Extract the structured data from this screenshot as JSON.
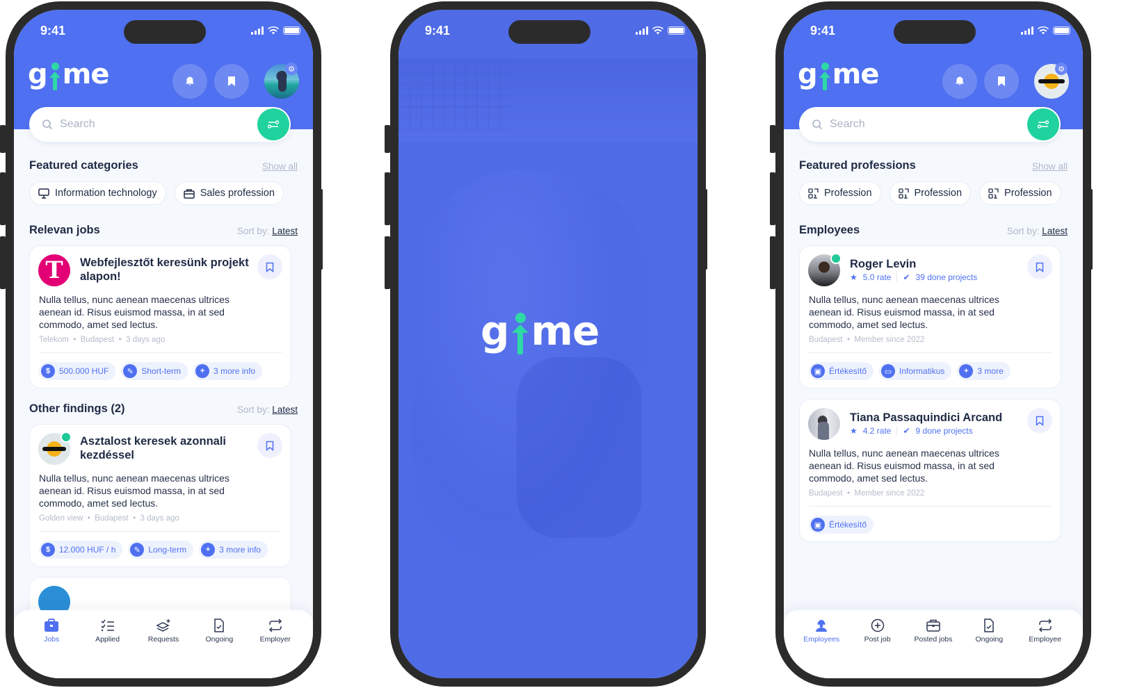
{
  "colors": {
    "brand": "#4f70f0",
    "accent_green": "#20d39e",
    "text_dark": "#1f2a44",
    "muted": "#b5bccb",
    "bg": "#f5f8fd"
  },
  "status_bar": {
    "time": "9:41"
  },
  "brand": {
    "logo_prefix": "g",
    "logo_suffix": "me"
  },
  "phone1": {
    "search_placeholder": "Search",
    "featured": {
      "title": "Featured categories",
      "show_all": "Show all",
      "chips": [
        {
          "icon": "monitor-icon",
          "label": "Information technology"
        },
        {
          "icon": "briefcase-icon",
          "label": "Sales profession"
        }
      ]
    },
    "relevant": {
      "title": "Relevan jobs",
      "sort_label": "Sort by:",
      "sort_value": "Latest"
    },
    "jobs": [
      {
        "title": "Webfejlesztőt keresünk projekt alapon!",
        "description": "Nulla tellus, nunc aenean maecenas ultrices aenean id. Risus euismod massa, in at sed commodo, amet sed lectus.",
        "company": "Telekom",
        "location": "Budapest",
        "posted": "3 days ago",
        "tags": [
          {
            "icon": "dollar-icon",
            "label": "500.000 HUF"
          },
          {
            "icon": "contract-icon",
            "label": "Short-term"
          },
          {
            "icon": "plus-icon",
            "label": "3 more info"
          }
        ]
      }
    ],
    "other": {
      "title": "Other findings (2)",
      "sort_label": "Sort by:",
      "sort_value": "Latest"
    },
    "other_jobs": [
      {
        "title": "Asztalost keresek azonnali kezdéssel",
        "description": "Nulla tellus, nunc aenean maecenas ultrices aenean id. Risus euismod massa, in at sed commodo, amet sed lectus.",
        "company": "Golden view",
        "location": "Budapest",
        "posted": "3 days ago",
        "tags": [
          {
            "icon": "dollar-icon",
            "label": "12.000 HUF / h"
          },
          {
            "icon": "contract-icon",
            "label": "Long-term"
          },
          {
            "icon": "plus-icon",
            "label": "3 more info"
          }
        ]
      }
    ],
    "nav": [
      {
        "label": "Jobs",
        "icon": "briefcase-icon",
        "active": true
      },
      {
        "label": "Applied",
        "icon": "checklist-icon",
        "active": false
      },
      {
        "label": "Requests",
        "icon": "layers-plus-icon",
        "active": false
      },
      {
        "label": "Ongoing",
        "icon": "file-check-icon",
        "active": false
      },
      {
        "label": "Employer",
        "icon": "switch-icon",
        "active": false
      }
    ]
  },
  "phone2": {
    "screen": "splash"
  },
  "phone3": {
    "search_placeholder": "Search",
    "featured": {
      "title": "Featured professions",
      "show_all": "Show all",
      "chips": [
        {
          "icon": "profession-icon",
          "label": "Profession"
        },
        {
          "icon": "profession-icon",
          "label": "Profession"
        },
        {
          "icon": "profession-icon",
          "label": "Profession"
        }
      ]
    },
    "employees_section": {
      "title": "Employees",
      "sort_label": "Sort by:",
      "sort_value": "Latest"
    },
    "employees": [
      {
        "name": "Roger Levin",
        "rate": "5.0 rate",
        "projects": "39 done projects",
        "verified": true,
        "description": "Nulla tellus, nunc aenean maecenas ultrices aenean id. Risus euismod massa, in at sed commodo, amet sed lectus.",
        "location": "Budapest",
        "member_since": "Member since 2022",
        "tags": [
          {
            "icon": "briefcase-icon",
            "label": "Értékesítő"
          },
          {
            "icon": "monitor-icon",
            "label": "Informatikus"
          },
          {
            "icon": "plus-icon",
            "label": "3 more"
          }
        ]
      },
      {
        "name": "Tiana Passaquindici Arcand",
        "rate": "4.2 rate",
        "projects": "9 done projects",
        "verified": false,
        "description": "Nulla tellus, nunc aenean maecenas ultrices aenean id. Risus euismod massa, in at sed commodo, amet sed lectus.",
        "location": "Budapest",
        "member_since": "Member since 2022",
        "tags": [
          {
            "icon": "briefcase-icon",
            "label": "Értékesítő"
          }
        ]
      }
    ],
    "nav": [
      {
        "label": "Employees",
        "icon": "worker-icon",
        "active": true
      },
      {
        "label": "Post job",
        "icon": "plus-circle-icon",
        "active": false
      },
      {
        "label": "Posted jobs",
        "icon": "briefcase-icon",
        "active": false
      },
      {
        "label": "Ongoing",
        "icon": "file-check-icon",
        "active": false
      },
      {
        "label": "Employee",
        "icon": "switch-icon",
        "active": false
      }
    ]
  }
}
